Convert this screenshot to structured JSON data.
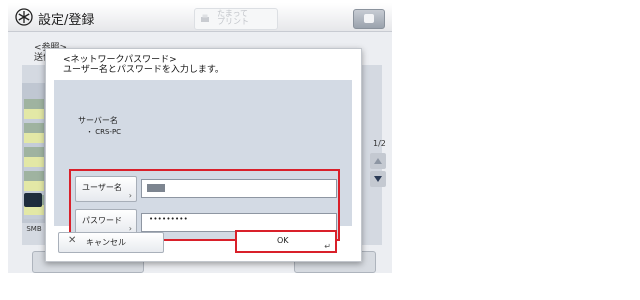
{
  "window": {
    "title": "設定/登録",
    "quick_print": "たまって\nプリント",
    "status_button": "",
    "home_icon": "home-star-icon",
    "status_icon": "status-monitor-icon"
  },
  "background": {
    "breadcrumb_line1": "<参照>",
    "breadcrumb_line2": "送信",
    "page_indicator": "1/2",
    "sidebar_label": "SMB",
    "cancel_label": "キャンセル"
  },
  "dialog": {
    "title": "<ネットワークパスワード>",
    "subtitle": "ユーザー名とパスワードを入力します。",
    "server_label": "サーバー名",
    "server_value": "・ CRS-PC",
    "username_label": "ユーザー名",
    "username_value": "",
    "password_label": "パスワード",
    "password_value": "•••••••••",
    "cancel_label": "キャンセル",
    "cancel_icon_glyph": "✕",
    "ok_label": "OK",
    "enter_glyph": "↵",
    "field_arrow_glyph": "›",
    "highlight_color": "#d9202a"
  }
}
